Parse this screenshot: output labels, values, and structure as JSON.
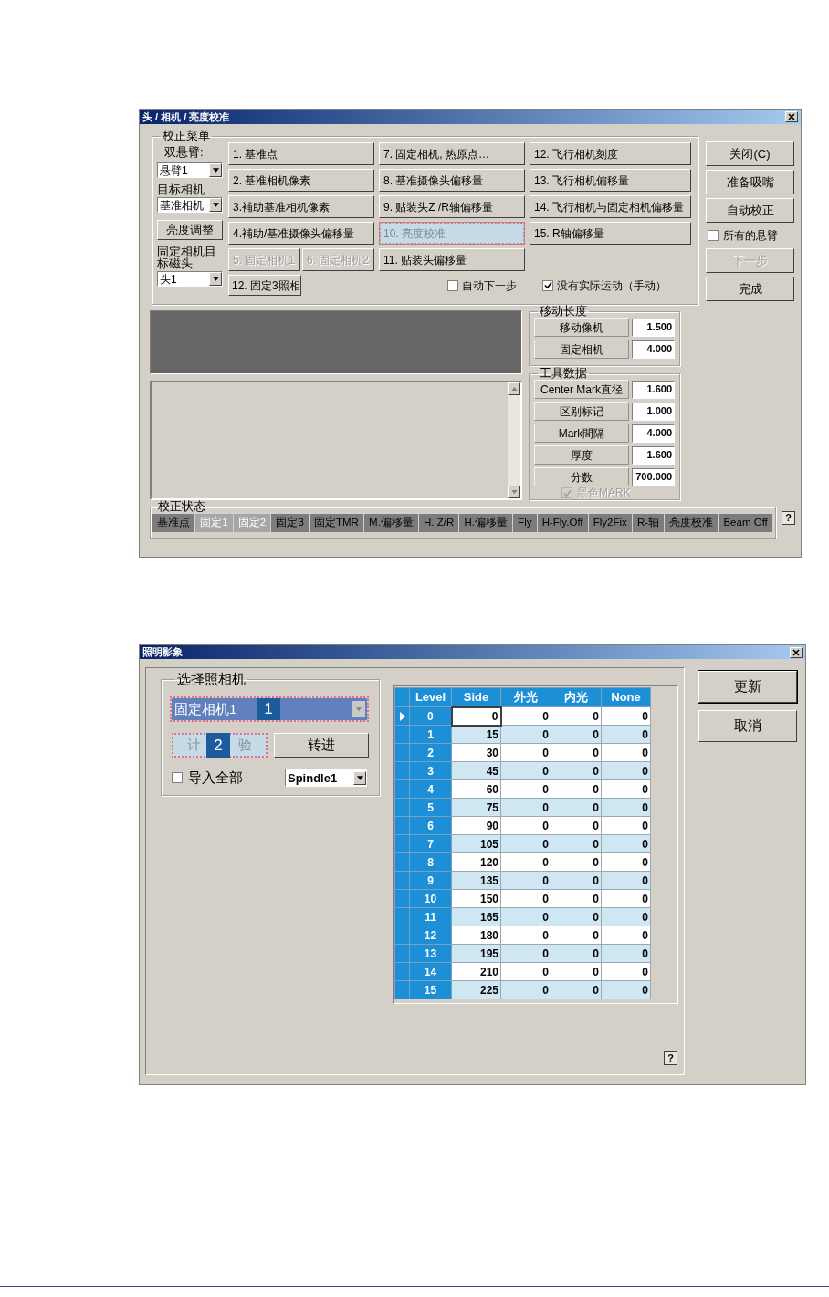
{
  "dialog1": {
    "title": "头 / 相机 / 亮度校准",
    "menu": {
      "title": "校正菜单",
      "left": [
        {
          "kind": "label",
          "text": "双悬臂:"
        },
        {
          "kind": "combo",
          "value": "悬臂1"
        },
        {
          "kind": "label",
          "text": "目标相机"
        },
        {
          "kind": "combo",
          "value": "基准相机"
        },
        {
          "kind": "button",
          "text": "亮度调整"
        },
        {
          "kind": "label",
          "text": "固定相机目标磁头"
        },
        {
          "kind": "combo",
          "value": "头1"
        }
      ],
      "columns": [
        [
          [
            {
              "label": "1. 基准点",
              "disabled": false,
              "selected": false
            }
          ],
          [
            {
              "label": "2. 基准相机像素",
              "disabled": false,
              "selected": false
            }
          ],
          [
            {
              "label": "3.補助基准相机像素",
              "disabled": false,
              "selected": false
            }
          ],
          [
            {
              "label": "4.補助/基准摄像头偏移量",
              "disabled": false,
              "selected": false
            }
          ],
          [
            {
              "label": "5. 固定相机1",
              "disabled": true,
              "selected": false
            },
            {
              "label": "6. 固定相机2",
              "disabled": true,
              "selected": false
            }
          ]
        ],
        [
          [
            {
              "label": "7. 固定相机, 热原点…",
              "disabled": false,
              "selected": false
            }
          ],
          [
            {
              "label": "8. 基准摄像头偏移量",
              "disabled": false,
              "selected": false
            }
          ],
          [
            {
              "label": "9. 贴装头Z /R轴偏移量",
              "disabled": false,
              "selected": false
            }
          ],
          [
            {
              "label": "10. 亮度校准",
              "disabled": true,
              "selected": true
            }
          ],
          [
            {
              "label": "11. 贴装头偏移量",
              "disabled": false,
              "selected": false
            }
          ]
        ],
        [
          [
            {
              "label": "12. 飞行相机刻度",
              "disabled": false,
              "selected": false
            }
          ],
          [
            {
              "label": "13. 飞行相机偏移量",
              "disabled": false,
              "selected": false
            }
          ],
          [
            {
              "label": "14. 飞行相机与固定相机偏移量",
              "disabled": false,
              "selected": false
            }
          ],
          [
            {
              "label": "15. R轴偏移量",
              "disabled": false,
              "selected": false
            }
          ]
        ]
      ],
      "extra_button": {
        "label": "12. 固定3照相"
      },
      "checkboxes": [
        {
          "label": "自动下一步",
          "checked": false
        },
        {
          "label": "没有实际运动（手动）",
          "checked": true
        }
      ]
    },
    "side": [
      {
        "kind": "button",
        "label": "关闭(C)",
        "disabled": false
      },
      {
        "kind": "button",
        "label": "准备吸嘴",
        "disabled": false
      },
      {
        "kind": "button",
        "label": "自动校正",
        "disabled": false
      },
      {
        "kind": "checkbox",
        "label": "所有的悬臂",
        "checked": false
      },
      {
        "kind": "button",
        "label": "下一步",
        "disabled": true
      },
      {
        "kind": "button",
        "label": "完成",
        "disabled": false
      }
    ],
    "move_length": {
      "title": "移动长度",
      "rows": [
        {
          "label": "移动像机",
          "value": "1.500"
        },
        {
          "label": "固定相机",
          "value": "4.000"
        }
      ]
    },
    "tool_data": {
      "title": "工具数据",
      "rows": [
        {
          "label": "Center Mark直径",
          "value": "1.600"
        },
        {
          "label": "区别标记",
          "value": "1.000"
        },
        {
          "label": "Mark間隔",
          "value": "4.000"
        },
        {
          "label": "厚度",
          "value": "1.600"
        },
        {
          "label": "分数",
          "value": "700.000"
        }
      ],
      "checkbox": {
        "label": "黑色MARK",
        "checked": true,
        "disabled": true
      }
    },
    "status": {
      "title": "校正状态",
      "cells": [
        {
          "label": "基准点",
          "disabled": false
        },
        {
          "label": "固定1",
          "disabled": true
        },
        {
          "label": "固定2",
          "disabled": true
        },
        {
          "label": "固定3",
          "disabled": false
        },
        {
          "label": "固定TMR",
          "disabled": false
        },
        {
          "label": "M.偏移量",
          "disabled": false
        },
        {
          "label": "H. Z/R",
          "disabled": false
        },
        {
          "label": "H.偏移量",
          "disabled": false
        },
        {
          "label": "Fly",
          "disabled": false
        },
        {
          "label": "H-Fly.Off",
          "disabled": false
        },
        {
          "label": "Fly2Fix",
          "disabled": false
        },
        {
          "label": "R-轴",
          "disabled": false
        },
        {
          "label": "亮度校准",
          "disabled": false
        },
        {
          "label": "Beam Off",
          "disabled": false
        }
      ]
    },
    "help": "?"
  },
  "dialog2": {
    "title": "照明影象",
    "camera_group": {
      "title": "选择照相机",
      "combo": {
        "value": "固定相机1",
        "selected": true,
        "badge": "1"
      },
      "test_button": {
        "label_start": "计",
        "label_end": "验",
        "selected": true,
        "badge": "2"
      },
      "advance_button": {
        "label": "转进"
      },
      "import_all": {
        "label": "导入全部",
        "checked": false
      },
      "spindle_combo": {
        "value": "Spindle1"
      }
    },
    "table": {
      "columns": [
        "Level",
        "Side",
        "外光",
        "内光",
        "None"
      ],
      "rows": [
        {
          "selected": true,
          "cells": [
            "0",
            "0",
            "0",
            "0",
            "0"
          ]
        },
        {
          "selected": false,
          "cells": [
            "1",
            "15",
            "0",
            "0",
            "0"
          ]
        },
        {
          "selected": false,
          "cells": [
            "2",
            "30",
            "0",
            "0",
            "0"
          ]
        },
        {
          "selected": false,
          "cells": [
            "3",
            "45",
            "0",
            "0",
            "0"
          ]
        },
        {
          "selected": false,
          "cells": [
            "4",
            "60",
            "0",
            "0",
            "0"
          ]
        },
        {
          "selected": false,
          "cells": [
            "5",
            "75",
            "0",
            "0",
            "0"
          ]
        },
        {
          "selected": false,
          "cells": [
            "6",
            "90",
            "0",
            "0",
            "0"
          ]
        },
        {
          "selected": false,
          "cells": [
            "7",
            "105",
            "0",
            "0",
            "0"
          ]
        },
        {
          "selected": false,
          "cells": [
            "8",
            "120",
            "0",
            "0",
            "0"
          ]
        },
        {
          "selected": false,
          "cells": [
            "9",
            "135",
            "0",
            "0",
            "0"
          ]
        },
        {
          "selected": false,
          "cells": [
            "10",
            "150",
            "0",
            "0",
            "0"
          ]
        },
        {
          "selected": false,
          "cells": [
            "11",
            "165",
            "0",
            "0",
            "0"
          ]
        },
        {
          "selected": false,
          "cells": [
            "12",
            "180",
            "0",
            "0",
            "0"
          ]
        },
        {
          "selected": false,
          "cells": [
            "13",
            "195",
            "0",
            "0",
            "0"
          ]
        },
        {
          "selected": false,
          "cells": [
            "14",
            "210",
            "0",
            "0",
            "0"
          ]
        },
        {
          "selected": false,
          "cells": [
            "15",
            "225",
            "0",
            "0",
            "0"
          ]
        }
      ]
    },
    "buttons": [
      {
        "label": "更新",
        "default": true
      },
      {
        "label": "取消",
        "default": false
      }
    ],
    "help": "?"
  }
}
